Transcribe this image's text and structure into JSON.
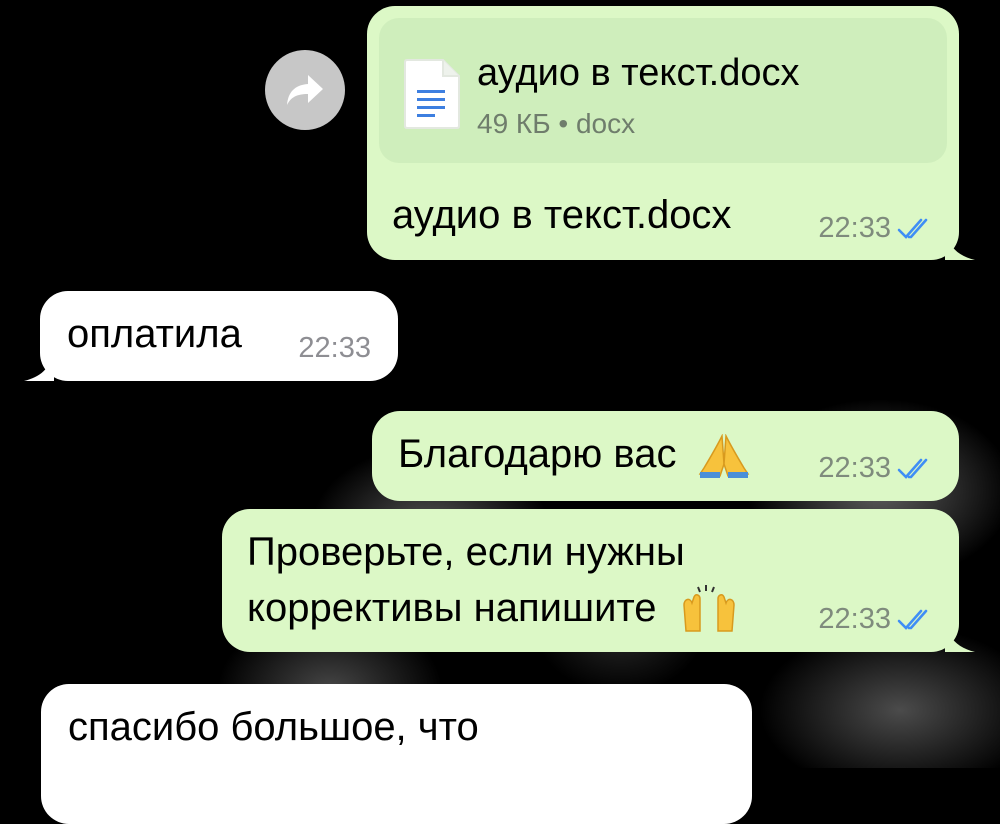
{
  "colors": {
    "outgoing_bubble": "#dcf8c6",
    "incoming_bubble": "#ffffff",
    "doc_card": "#cfeebc",
    "read_ticks": "#3f8ef5",
    "background": "#000000"
  },
  "forward_button": {
    "icon": "forward-arrow-icon"
  },
  "messages": [
    {
      "direction": "outgoing",
      "attachment": {
        "icon": "document-icon",
        "file_name": "аудио в текст.docx",
        "info": "49 КБ • docx"
      },
      "text": "аудио в текст.docx",
      "time": "22:33",
      "status": "read"
    },
    {
      "direction": "incoming",
      "text": "оплатила",
      "time": "22:33"
    },
    {
      "direction": "outgoing",
      "text": "Благодарю вас",
      "emoji": "folded-hands-emoji",
      "time": "22:33",
      "status": "read"
    },
    {
      "direction": "outgoing",
      "lines": [
        "Проверьте, если нужны",
        "коррективы напишите"
      ],
      "emoji": "raising-hands-emoji",
      "time": "22:33",
      "status": "read"
    },
    {
      "direction": "incoming",
      "text": "спасибо большое, что"
    }
  ]
}
